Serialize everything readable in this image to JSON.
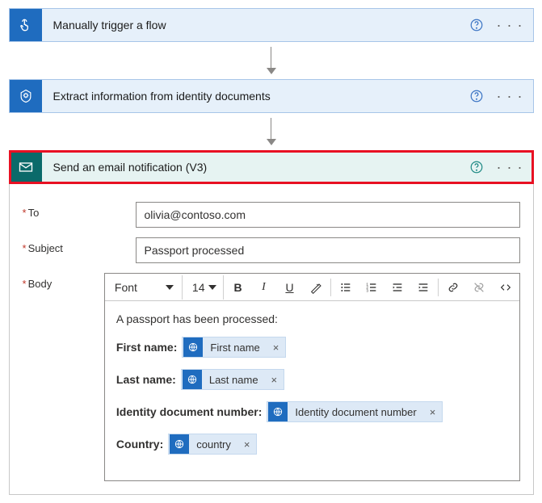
{
  "steps": {
    "s1": {
      "title": "Manually trigger a flow"
    },
    "s2": {
      "title": "Extract information from identity documents"
    },
    "s3": {
      "title": "Send an email notification (V3)"
    }
  },
  "form": {
    "labels": {
      "to": "To",
      "subject": "Subject",
      "body": "Body"
    },
    "to_value": "olivia@contoso.com",
    "subject_value": "Passport processed"
  },
  "toolbar": {
    "font_label": "Font",
    "size_label": "14"
  },
  "body": {
    "intro": "A passport has been processed:",
    "lines": {
      "first": {
        "label": "First name:",
        "token": "First name"
      },
      "last": {
        "label": "Last name:",
        "token": "Last name"
      },
      "idnum": {
        "label": "Identity document number:",
        "token": "Identity document number"
      },
      "country": {
        "label": "Country:",
        "token": "country"
      }
    }
  }
}
